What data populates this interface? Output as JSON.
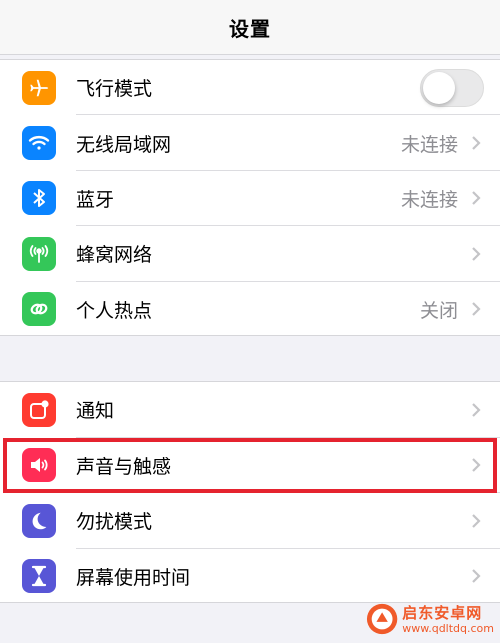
{
  "nav": {
    "title": "设置"
  },
  "group1": [
    {
      "label": "飞行模式",
      "icon": "airplane-icon",
      "color": "#ff9500",
      "value": "",
      "control": "toggle",
      "toggle_on": false
    },
    {
      "label": "无线局域网",
      "icon": "wifi-icon",
      "color": "#0a84ff",
      "value": "未连接",
      "control": "chevron"
    },
    {
      "label": "蓝牙",
      "icon": "bluetooth-icon",
      "color": "#0a84ff",
      "value": "未连接",
      "control": "chevron"
    },
    {
      "label": "蜂窝网络",
      "icon": "cellular-icon",
      "color": "#34c759",
      "value": "",
      "control": "chevron"
    },
    {
      "label": "个人热点",
      "icon": "hotspot-icon",
      "color": "#34c759",
      "value": "关闭",
      "control": "chevron"
    }
  ],
  "group2": [
    {
      "label": "通知",
      "icon": "notification-icon",
      "color": "#ff3b30",
      "value": "",
      "control": "chevron"
    },
    {
      "label": "声音与触感",
      "icon": "speaker-icon",
      "color": "#ff2d55",
      "value": "",
      "control": "chevron",
      "highlighted": true
    },
    {
      "label": "勿扰模式",
      "icon": "moon-icon",
      "color": "#5856d6",
      "value": "",
      "control": "chevron"
    },
    {
      "label": "屏幕使用时间",
      "icon": "hourglass-icon",
      "color": "#5856d6",
      "value": "",
      "control": "chevron"
    }
  ],
  "colors": {
    "highlight": "#e5232f",
    "background": "#f2f2f7",
    "watermark": "#f05a2a"
  },
  "watermark": {
    "title": "启东安卓网",
    "url": "www.qdltdq.com"
  }
}
